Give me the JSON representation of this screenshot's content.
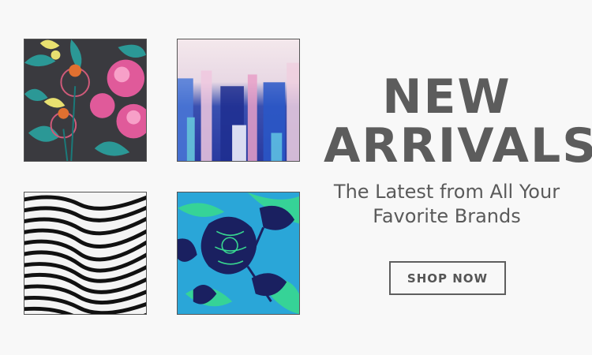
{
  "headline": {
    "line1": "NEW",
    "line2": "ARRIVALS"
  },
  "subheadline": {
    "line1": "The Latest from All Your",
    "line2": "Favorite Brands"
  },
  "cta": {
    "label": "SHOP NOW"
  },
  "colors": {
    "text": "#5c5c5c",
    "background": "#f8f8f8",
    "button_border": "#5e5e5e"
  },
  "swatches": [
    {
      "pattern": "floral-pink-on-charcoal"
    },
    {
      "pattern": "blurred-blue-abstract"
    },
    {
      "pattern": "black-white-wavy-stripes"
    },
    {
      "pattern": "navy-floral-on-turquoise"
    }
  ]
}
